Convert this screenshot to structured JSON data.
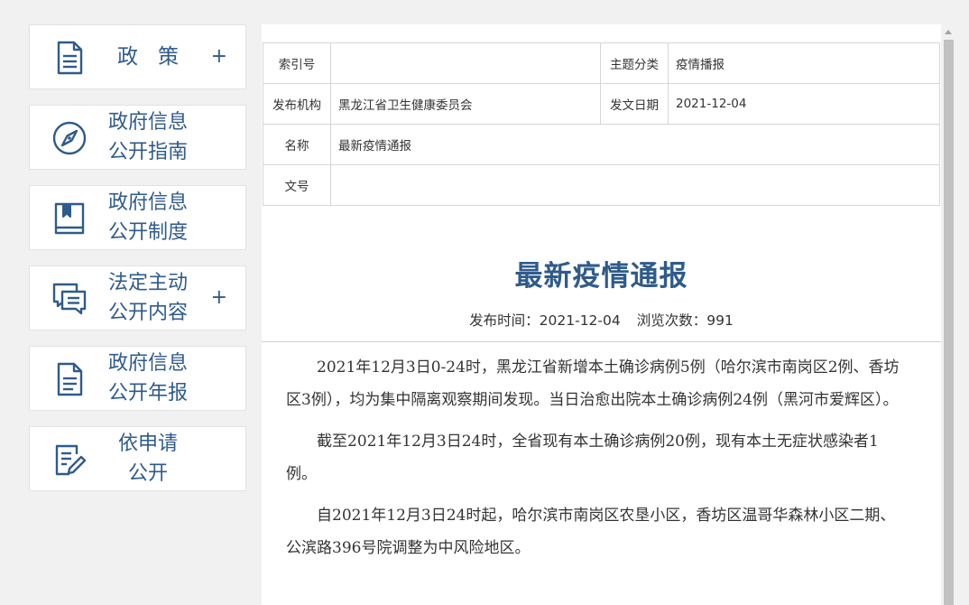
{
  "sidebar": {
    "items": [
      {
        "lines": [
          "政策"
        ],
        "plus": "+",
        "icon": "document-icon"
      },
      {
        "lines": [
          "政府信息",
          "公开指南"
        ],
        "plus": "",
        "icon": "compass-icon"
      },
      {
        "lines": [
          "政府信息",
          "公开制度"
        ],
        "plus": "",
        "icon": "book-icon"
      },
      {
        "lines": [
          "法定主动",
          "公开内容"
        ],
        "plus": "+",
        "icon": "chat-icon"
      },
      {
        "lines": [
          "政府信息",
          "公开年报"
        ],
        "plus": "",
        "icon": "report-icon"
      },
      {
        "lines": [
          "依申请",
          "公开"
        ],
        "plus": "",
        "icon": "edit-document-icon"
      }
    ]
  },
  "meta": {
    "index_label": "索引号",
    "index_value": "",
    "topic_label": "主题分类",
    "topic_value": "疫情播报",
    "issuer_label": "发布机构",
    "issuer_value": "黑龙江省卫生健康委员会",
    "date_label": "发文日期",
    "date_value": "2021-12-04",
    "name_label": "名称",
    "name_value": "最新疫情通报",
    "docno_label": "文号",
    "docno_value": ""
  },
  "article": {
    "title": "最新疫情通报",
    "publish_label": "发布时间：",
    "publish_date": "2021-12-04",
    "views_label": "浏览次数：",
    "views": "991",
    "paragraphs": [
      "2021年12月3日0-24时，黑龙江省新增本土确诊病例5例（哈尔滨市南岗区2例、香坊区3例），均为集中隔离观察期间发现。当日治愈出院本土确诊病例24例（黑河市爱辉区）。",
      "截至2021年12月3日24时，全省现有本土确诊病例20例，现有本土无症状感染者1例。",
      "自2021年12月3日24时起，哈尔滨市南岗区农垦小区，香坊区温哥华森林小区二期、公滨路396号院调整为中风险地区。"
    ]
  },
  "colors": {
    "accent": "#2f5b8c",
    "background": "#f1f1f1"
  }
}
